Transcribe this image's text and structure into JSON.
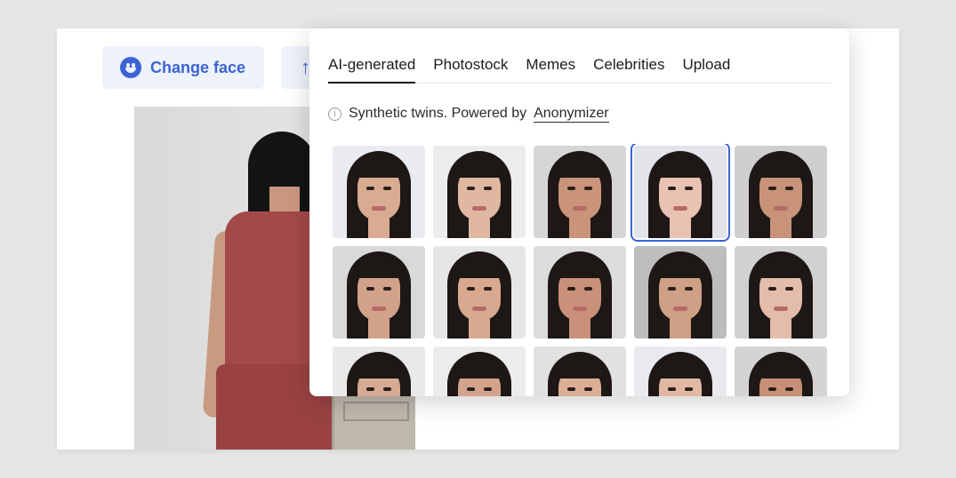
{
  "toolbar": {
    "change_face_label": "Change face",
    "change_face_icon": "smiley-face-icon",
    "second_button_icon": "upload-arrow-icon",
    "accent_color": "#3b63d4"
  },
  "picker": {
    "tabs": [
      {
        "label": "AI-generated",
        "active": true
      },
      {
        "label": "Photostock",
        "active": false
      },
      {
        "label": "Memes",
        "active": false
      },
      {
        "label": "Celebrities",
        "active": false
      },
      {
        "label": "Upload",
        "active": false
      }
    ],
    "info_text": "Synthetic twins. Powered by",
    "info_link": "Anonymizer",
    "faces": [
      {
        "skin": "#d9ab93",
        "bg": "#e9ebf1",
        "selected": false
      },
      {
        "skin": "#e0b7a1",
        "bg": "#ececec",
        "selected": false
      },
      {
        "skin": "#c99479",
        "bg": "#d6d6d6",
        "selected": false
      },
      {
        "skin": "#e9c2b3",
        "bg": "#e2e4ea",
        "selected": true
      },
      {
        "skin": "#c89378",
        "bg": "#cfcfcf",
        "selected": false
      },
      {
        "skin": "#d2a28a",
        "bg": "#d9d9d9",
        "selected": false
      },
      {
        "skin": "#d8a98f",
        "bg": "#e6e6e6",
        "selected": false
      },
      {
        "skin": "#c9917a",
        "bg": "#dcdcdc",
        "selected": false
      },
      {
        "skin": "#cf9f86",
        "bg": "#bdbdbd",
        "selected": false
      },
      {
        "skin": "#e3bcaa",
        "bg": "#d1d1d1",
        "selected": false
      },
      {
        "skin": "#d6aa93",
        "bg": "#e9e9e9",
        "selected": false
      },
      {
        "skin": "#d3a48b",
        "bg": "#ececec",
        "selected": false
      },
      {
        "skin": "#dcae96",
        "bg": "#e1e1e1",
        "selected": false
      },
      {
        "skin": "#e0b8a4",
        "bg": "#e8eaee",
        "selected": false
      },
      {
        "skin": "#c79076",
        "bg": "#d4d4d4",
        "selected": false
      }
    ]
  }
}
